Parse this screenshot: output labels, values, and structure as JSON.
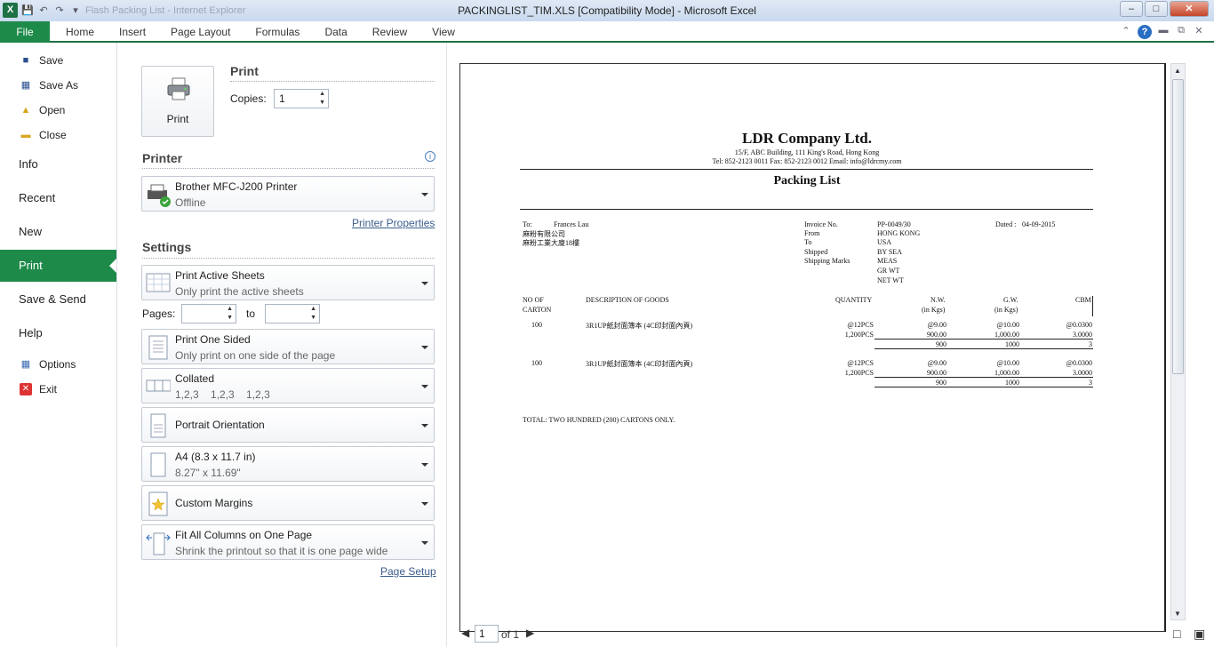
{
  "window": {
    "title": "PACKINGLIST_TIM.XLS  [Compatibility Mode]  -  Microsoft Excel",
    "app_icon": "X",
    "qat_ghost": "Flash Packing List - Internet Explorer",
    "btn_min": "–",
    "btn_max": "□",
    "btn_close": "✕"
  },
  "ribbon": {
    "file_label": "File",
    "tabs": [
      "Home",
      "Insert",
      "Page Layout",
      "Formulas",
      "Data",
      "Review",
      "View"
    ],
    "help": "?"
  },
  "nav": {
    "save": "Save",
    "save_as": "Save As",
    "open": "Open",
    "close": "Close",
    "info": "Info",
    "recent": "Recent",
    "new": "New",
    "print": "Print",
    "save_send": "Save & Send",
    "help": "Help",
    "options": "Options",
    "exit": "Exit"
  },
  "print": {
    "heading": "Print",
    "button_label": "Print",
    "copies_label": "Copies:",
    "copies_value": "1"
  },
  "printer": {
    "heading": "Printer",
    "name": "Brother MFC-J200 Printer",
    "status": "Offline",
    "properties_link": "Printer Properties"
  },
  "settings": {
    "heading": "Settings",
    "sheets_title": "Print Active Sheets",
    "sheets_sub": "Only print the active sheets",
    "pages_label": "Pages:",
    "pages_to": "to",
    "sided_title": "Print One Sided",
    "sided_sub": "Only print on one side of the page",
    "collated_title": "Collated",
    "collated_sub": "1,2,3    1,2,3    1,2,3",
    "orientation": "Portrait Orientation",
    "paper_title": "A4 (8.3 x 11.7 in)",
    "paper_sub": "8.27\" x 11.69\"",
    "margins": "Custom Margins",
    "scaling_title": "Fit All Columns on One Page",
    "scaling_sub": "Shrink the printout so that it is one page wide",
    "page_setup_link": "Page Setup"
  },
  "preview_nav": {
    "page": "1",
    "of": "of 1"
  },
  "document": {
    "company": "LDR Company Ltd.",
    "address": "15/F, ABC Building, 111 King's Road, Hong Kong",
    "contact": "Tel: 852-2123 0011   Fax: 852-2123 0012   Email: info@ldrcmy.com",
    "doc_title": "Packing List",
    "to_label": "To:",
    "to_name": "Frances Lau",
    "to_line2": "麻粉有限公司",
    "to_line3": "麻粉工業大廈18樓",
    "invoice_label": "Invoice No.",
    "invoice_value": "PP-0049/30",
    "dated_label": "Dated :",
    "dated_value": "04-09-2015",
    "from_label": "From",
    "from_value": "HONG KONG",
    "to2_label": "To",
    "to2_value": "USA",
    "shipped_label": "Shipped",
    "shipped_value": "BY SEA",
    "marks_label": "Shipping Marks",
    "marks_1": "MEAS",
    "marks_2": "GR WT",
    "marks_3": "NET WT",
    "col_no": "NO OF",
    "col_no2": "CARTON",
    "col_desc": "DESCRIPTION OF GOODS",
    "col_qty": "QUANTITY",
    "col_nw": "N.W.",
    "col_nw2": "(in Kgs)",
    "col_gw": "G.W.",
    "col_gw2": "(in Kgs)",
    "col_cbm": "CBM",
    "r1_no": "100",
    "r1_desc": "3R1UP紙封面簿本 (4C印封面內頁)",
    "r1_q1": "@12PCS",
    "r1_q2": "1,200PCS",
    "r1_nw1": "@9.00",
    "r1_nw2": "900.00",
    "r1_nw3": "900",
    "r1_gw1": "@10.00",
    "r1_gw2": "1,000.00",
    "r1_gw3": "1000",
    "r1_cb1": "@0.0300",
    "r1_cb2": "3.0000",
    "r1_cb3": "3",
    "r2_no": "100",
    "r2_desc": "3R1UP紙封面簿本 (4C印封面內頁)",
    "r2_q1": "@12PCS",
    "r2_q2": "1,200PCS",
    "r2_nw1": "@9.00",
    "r2_nw2": "900.00",
    "r2_nw3": "900",
    "r2_gw1": "@10.00",
    "r2_gw2": "1,000.00",
    "r2_gw3": "1000",
    "r2_cb1": "@0.0300",
    "r2_cb2": "3.0000",
    "r2_cb3": "3",
    "total": "TOTAL:  TWO HUNDRED  (200) CARTONS ONLY."
  }
}
